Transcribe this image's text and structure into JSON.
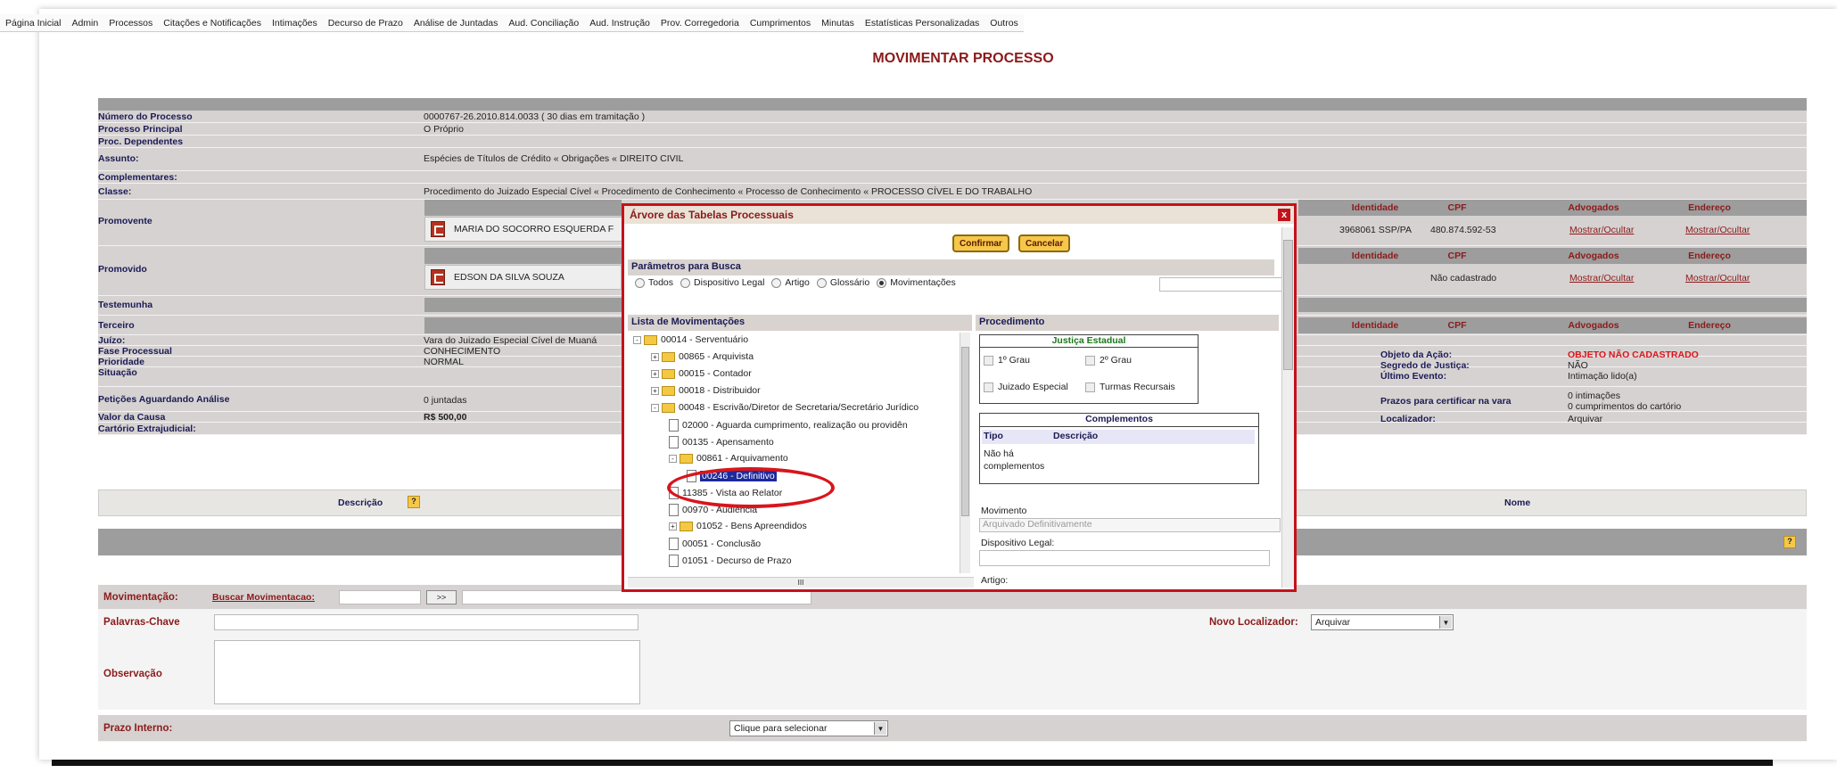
{
  "topnav": [
    "Página Inicial",
    "Admin",
    "Processos",
    "Citações e Notificações",
    "Intimações",
    "Decurso de Prazo",
    "Análise de Juntadas",
    "Aud. Conciliação",
    "Aud. Instrução",
    "Prov. Corregedoria",
    "Cumprimentos",
    "Minutas",
    "Estatísticas Personalizadas",
    "Outros"
  ],
  "page_title": "MOVIMENTAR PROCESSO",
  "process": {
    "numero_label": "Número do Processo",
    "numero_value": "0000767-26.2010.814.0033 ( 30 dias em tramitação )",
    "principal_label": "Processo Principal",
    "principal_value": "O Próprio",
    "dependentes_label": "Proc. Dependentes",
    "assunto_label": "Assunto:",
    "assunto_value": "Espécies de Títulos de Crédito « Obrigações « DIREITO CIVIL",
    "complementares_label": "Complementares:",
    "classe_label": "Classe:",
    "classe_value": "Procedimento do Juizado Especial Cível « Procedimento de Conhecimento « Processo de Conhecimento « PROCESSO CÍVEL E DO TRABALHO",
    "promovente_label": "Promovente",
    "promovente_name": "MARIA DO SOCORRO ESQUERDA F",
    "promovido_label": "Promovido",
    "promovido_name": "EDSON DA SILVA SOUZA",
    "testemunha_label": "Testemunha",
    "terceiro_label": "Terceiro",
    "juizo_label": "Juízo:",
    "juizo_value": "Vara do Juizado Especial Cível de Muaná",
    "fase_label": "Fase Processual",
    "fase_value": "CONHECIMENTO",
    "prioridade_label": "Prioridade",
    "prioridade_value": "NORMAL",
    "situacao_label": "Situação",
    "peticoes_label": "Petições Aguardando Análise",
    "peticoes_value": "0 juntadas",
    "valor_label": "Valor da Causa",
    "valor_value": "R$ 500,00",
    "cartorio_label": "Cartório Extrajudicial:"
  },
  "party_headers": {
    "identidade": "Identidade",
    "cpf": "CPF",
    "advogados": "Advogados",
    "endereco": "Endereço"
  },
  "promovente_right": {
    "identidade": "3968061 SSP/PA",
    "cpf": "480.874.592-53",
    "advogados": "Mostrar/Ocultar",
    "endereco": "Mostrar/Ocultar"
  },
  "promovido_right": {
    "cpf": "Não cadastrado",
    "advogados": "Mostrar/Ocultar",
    "endereco": "Mostrar/Ocultar"
  },
  "right_info": {
    "objeto_label": "Objeto da Ação:",
    "objeto_value": "OBJETO NÃO CADASTRADO",
    "segredo_label": "Segredo de Justiça:",
    "segredo_value": "NÃO",
    "ultimo_label": "Último Evento:",
    "ultimo_value": "Intimação lido(a)",
    "prazos_label": "Prazos para certificar na vara",
    "prazos_value1": "0 intimações",
    "prazos_value2": "0 cumprimentos do cartório",
    "localizador_label": "Localizador:",
    "localizador_value": "Arquivar"
  },
  "lower_table": {
    "descricao": "Descrição",
    "nome": "Nome",
    "help": "?"
  },
  "bottom": {
    "movimentacao_label": "Movimentação:",
    "buscar_link": "Buscar Movimentacao:",
    "go_button": ">>",
    "palavras_label": "Palavras-Chave",
    "novo_localizador_label": "Novo Localizador:",
    "novo_localizador_value": "Arquivar",
    "observacao_label": "Observação",
    "prazo_label": "Prazo Interno:",
    "prazo_select": "Clique para selecionar"
  },
  "modal": {
    "title": "Árvore das Tabelas Processuais",
    "close": "x",
    "confirm": "Confirmar",
    "cancel": "Cancelar",
    "params_header": "Parâmetros para Busca",
    "radios": [
      {
        "label": "Todos",
        "on": false
      },
      {
        "label": "Dispositivo Legal",
        "on": false
      },
      {
        "label": "Artigo",
        "on": false
      },
      {
        "label": "Glossário",
        "on": false
      },
      {
        "label": "Movimentações",
        "on": true
      }
    ],
    "list_header": "Lista de Movimentações",
    "tree": [
      {
        "label": "00014 - Serventuário",
        "type": "folder",
        "indent": 0,
        "sign": "-"
      },
      {
        "label": "00865 - Arquivista",
        "type": "folder",
        "indent": 1,
        "sign": "+"
      },
      {
        "label": "00015 - Contador",
        "type": "folder",
        "indent": 1,
        "sign": "+"
      },
      {
        "label": "00018 - Distribuidor",
        "type": "folder",
        "indent": 1,
        "sign": "+"
      },
      {
        "label": "00048 - Escrivão/Diretor de Secretaria/Secretário Jurídico",
        "type": "folder",
        "indent": 1,
        "sign": "-"
      },
      {
        "label": "02000 - Aguarda cumprimento, realização ou providên",
        "type": "page",
        "indent": 2,
        "sign": ""
      },
      {
        "label": "00135 - Apensamento",
        "type": "page",
        "indent": 2,
        "sign": ""
      },
      {
        "label": "00861 - Arquivamento",
        "type": "folder",
        "indent": 2,
        "sign": "-"
      },
      {
        "label": "00246 - Definitivo",
        "type": "page",
        "indent": 3,
        "sign": "",
        "selected": true
      },
      {
        "label": "11385 - Vista ao Relator",
        "type": "page",
        "indent": 2,
        "sign": ""
      },
      {
        "label": "00970 - Audiência",
        "type": "page",
        "indent": 2,
        "sign": ""
      },
      {
        "label": "01052 - Bens Apreendidos",
        "type": "folder",
        "indent": 2,
        "sign": "+"
      },
      {
        "label": "00051 - Conclusão",
        "type": "page",
        "indent": 2,
        "sign": ""
      },
      {
        "label": "01051 - Decurso de Prazo",
        "type": "page",
        "indent": 2,
        "sign": ""
      }
    ],
    "procedimento_header": "Procedimento",
    "justica_title": "Justiça Estadual",
    "grau1": "1º Grau",
    "grau2": "2º Grau",
    "juizado": "Juizado Especial",
    "turmas": "Turmas Recursais",
    "complementos_title": "Complementos",
    "tipo": "Tipo",
    "descricao": "Descrição",
    "nao_ha": "Não há complementos",
    "movimento_label": "Movimento",
    "movimento_value": "Arquivado Definitivamente",
    "dispositivo_label": "Dispositivo Legal:",
    "artigo_label": "Artigo:",
    "hscroll_mark": "III"
  }
}
